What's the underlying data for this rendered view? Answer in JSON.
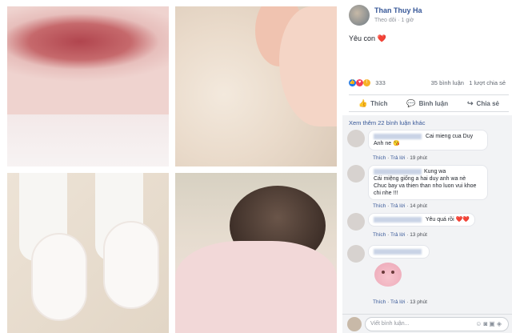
{
  "post": {
    "author": "Than Thuy Ha",
    "follow": "Theo dõi",
    "time": "1 giờ",
    "message": "Yêu con",
    "heart": "❤️",
    "reaction_count": "333",
    "comment_count": "35 bình luận",
    "share_count": "1 lượt chia sẻ"
  },
  "actions": {
    "like": "Thích",
    "comment": "Bình luận",
    "share": "Chia sẻ"
  },
  "comments": {
    "more": "Xem thêm 22 bình luận khác",
    "items": [
      {
        "text": "Cai mieng cua Duy Anh ne 😘",
        "like": "Thích",
        "reply": "Trả lời",
        "time": "19 phút"
      },
      {
        "text": "Kung wa\nCái miệng giống a hai duy anh wa nè\nChuc bay va thien than nho luon vui khoe chi nhe !!!",
        "like": "Thích",
        "reply": "Trả lời",
        "time": "14 phút"
      },
      {
        "text": "Yêu quá rồi ❤️❤️",
        "like": "Thích",
        "reply": "Trả lời",
        "time": "13 phút"
      },
      {
        "text": "",
        "like": "Thích",
        "reply": "Trả lời",
        "time": "13 phút"
      }
    ]
  },
  "write": {
    "placeholder": "Viết bình luận..."
  },
  "icons": [
    "like-icon",
    "comment-icon",
    "share-icon",
    "emoji-icon",
    "camera-icon",
    "gif-icon",
    "sticker-icon"
  ],
  "colors": {
    "link": "#385898",
    "like": "#1877f2",
    "love": "#f33e58"
  }
}
